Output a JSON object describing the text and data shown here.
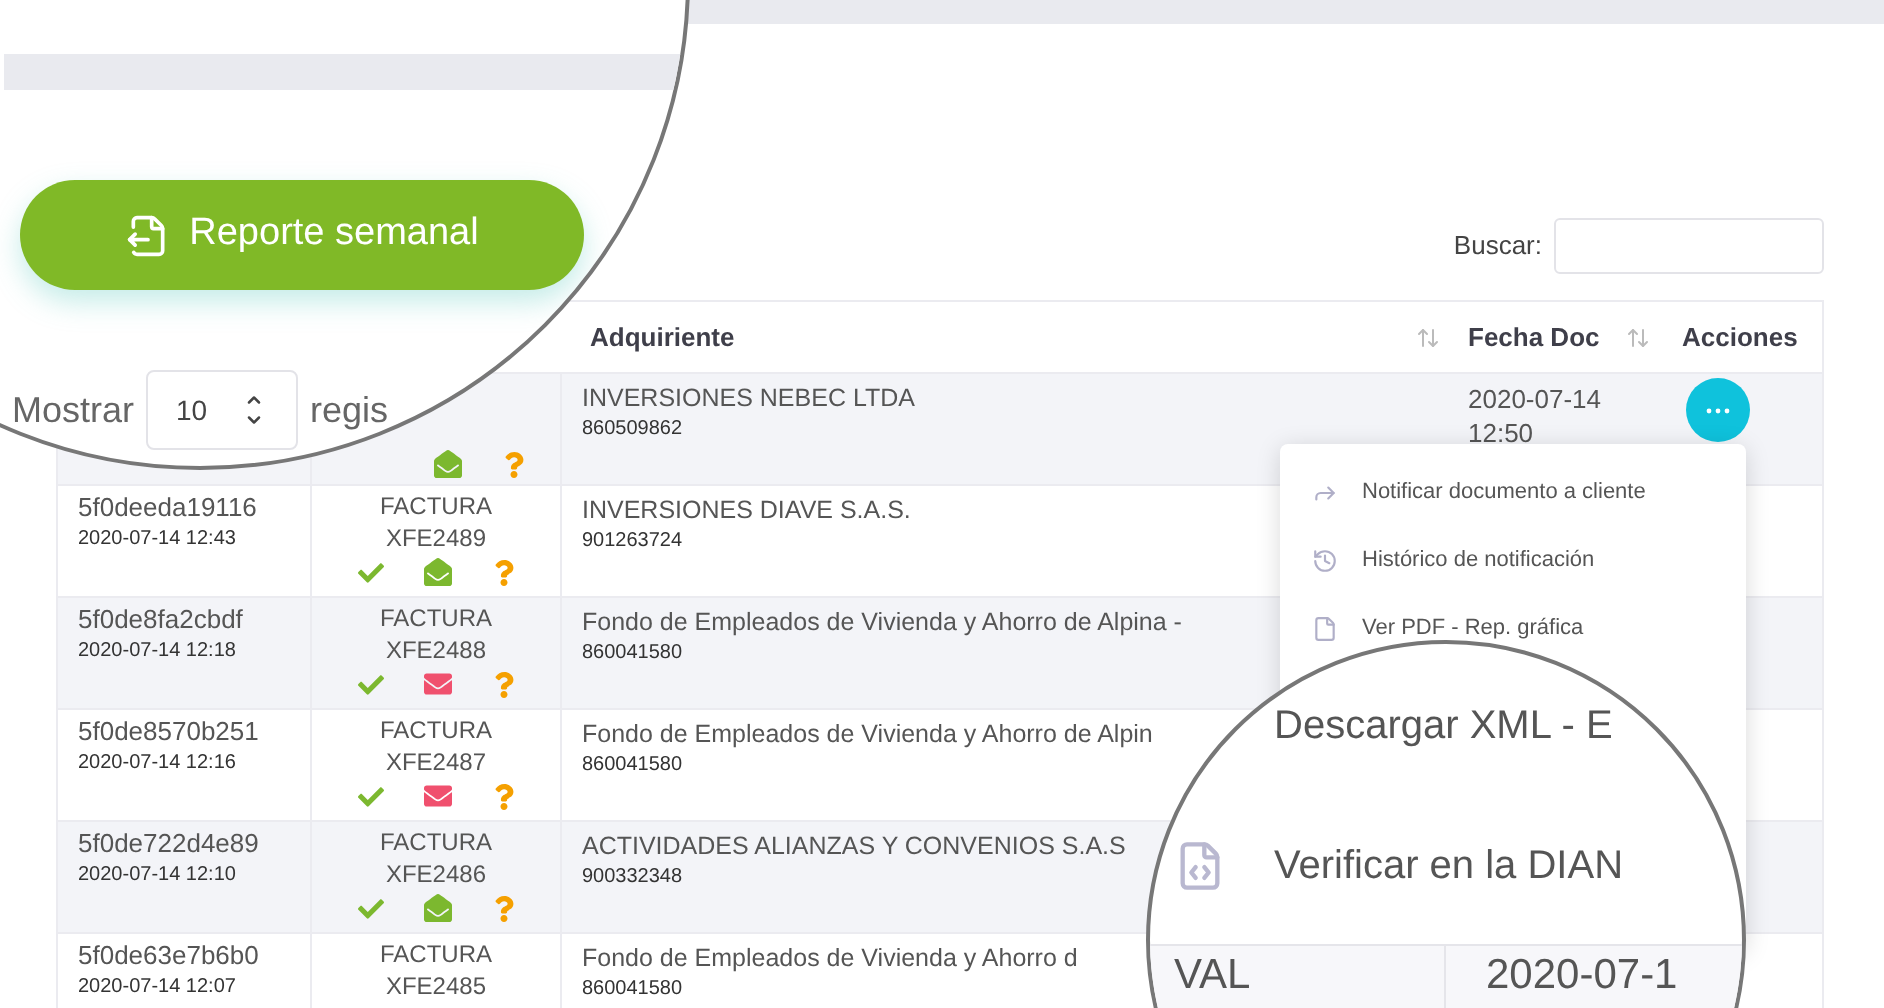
{
  "top_magnifier": {
    "report_button": "Reporte semanal",
    "show_label": "Mostrar",
    "page_size": "10",
    "records_label": "regis"
  },
  "search": {
    "label": "Buscar:"
  },
  "table": {
    "columns": [
      {
        "label": "Adquiriente",
        "sortable": true
      },
      {
        "label": "Fecha Doc",
        "sortable": true
      },
      {
        "label": "Acciones",
        "sortable": false
      }
    ],
    "rows": [
      {
        "icons": [
          {
            "kind": "mail_open",
            "color": "#7cb82f"
          },
          {
            "kind": "question"
          }
        ],
        "buyer": "INVERSIONES NEBEC LTDA",
        "buyer_id": "860509862",
        "doc_date": "2020-07-14",
        "doc_time": "12:50",
        "actions_open": true
      },
      {
        "id": "5f0deeda19116",
        "created": "2020-07-14 12:43",
        "doc_type": "FACTURA",
        "doc_number": "XFE2489",
        "icons": [
          {
            "kind": "check"
          },
          {
            "kind": "mail_open",
            "color": "#7cb82f"
          },
          {
            "kind": "question"
          }
        ],
        "buyer": "INVERSIONES DIAVE S.A.S.",
        "buyer_id": "901263724"
      },
      {
        "id": "5f0de8fa2cbdf",
        "created": "2020-07-14 12:18",
        "doc_type": "FACTURA",
        "doc_number": "XFE2488",
        "icons": [
          {
            "kind": "check"
          },
          {
            "kind": "mail_closed",
            "color": "#f0506e"
          },
          {
            "kind": "question"
          }
        ],
        "buyer": "Fondo de Empleados de Vivienda y Ahorro de Alpina -",
        "buyer_id": "860041580"
      },
      {
        "id": "5f0de8570b251",
        "created": "2020-07-14 12:16",
        "doc_type": "FACTURA",
        "doc_number": "XFE2487",
        "icons": [
          {
            "kind": "check"
          },
          {
            "kind": "mail_closed",
            "color": "#f0506e"
          },
          {
            "kind": "question"
          }
        ],
        "buyer": "Fondo de Empleados de Vivienda y Ahorro de Alpin",
        "buyer_id": "860041580"
      },
      {
        "id": "5f0de722d4e89",
        "created": "2020-07-14 12:10",
        "doc_type": "FACTURA",
        "doc_number": "XFE2486",
        "icons": [
          {
            "kind": "check"
          },
          {
            "kind": "mail_open",
            "color": "#7cb82f"
          },
          {
            "kind": "question"
          }
        ],
        "buyer": "ACTIVIDADES ALIANZAS Y CONVENIOS S.A.S",
        "buyer_id": "900332348"
      },
      {
        "id": "5f0de63e7b6b0",
        "created": "2020-07-14 12:07",
        "doc_type": "FACTURA",
        "doc_number": "XFE2485",
        "buyer": "Fondo de Empleados de Vivienda y Ahorro d",
        "buyer_id": "860041580"
      }
    ]
  },
  "actions_menu": {
    "items": [
      {
        "kind": "notify",
        "label": "Notificar documento a cliente"
      },
      {
        "kind": "history",
        "label": "Histórico de notificación"
      },
      {
        "kind": "pdf",
        "label": "Ver PDF - Rep. gráfica"
      }
    ]
  },
  "bottom_magnifier": {
    "items": [
      {
        "kind": "download",
        "label": "Descargar XML - E"
      },
      {
        "kind": "verify",
        "label": "Verificar en la DIAN"
      }
    ],
    "cells": [
      "VAL",
      "2020-07-1"
    ]
  }
}
